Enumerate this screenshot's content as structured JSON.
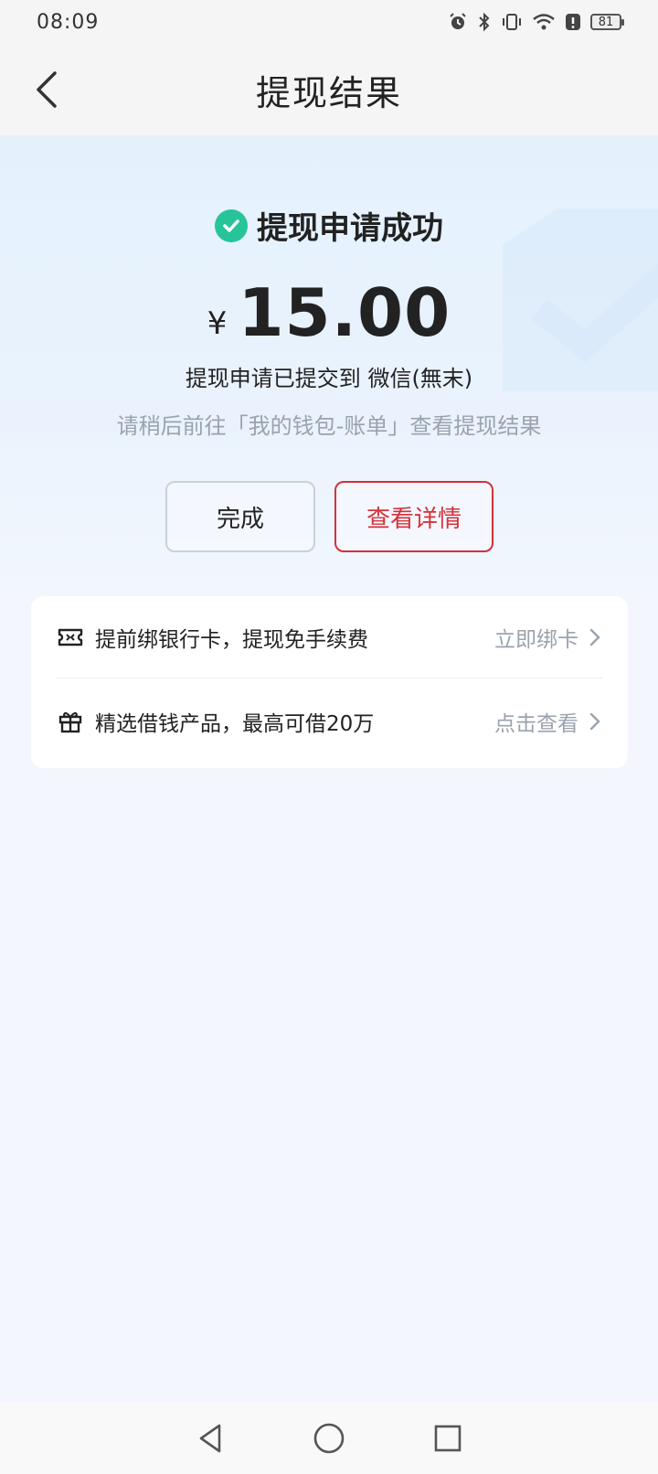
{
  "status_bar": {
    "time": "08:09",
    "battery": "81"
  },
  "nav": {
    "title": "提现结果"
  },
  "result": {
    "status": "提现申请成功",
    "currency_symbol": "¥",
    "amount": "15.00",
    "submitted_text": "提现申请已提交到 微信(無末)",
    "hint": "请稍后前往「我的钱包-账单」查看提现结果"
  },
  "buttons": {
    "done": "完成",
    "view_detail": "查看详情"
  },
  "promos": [
    {
      "label": "提前绑银行卡，提现免手续费",
      "action": "立即绑卡",
      "icon": "ticket-icon"
    },
    {
      "label": "精选借钱产品，最高可借20万",
      "action": "点击查看",
      "icon": "gift-icon"
    }
  ],
  "colors": {
    "accent_red": "#d6313a",
    "success_green": "#27c49a"
  }
}
